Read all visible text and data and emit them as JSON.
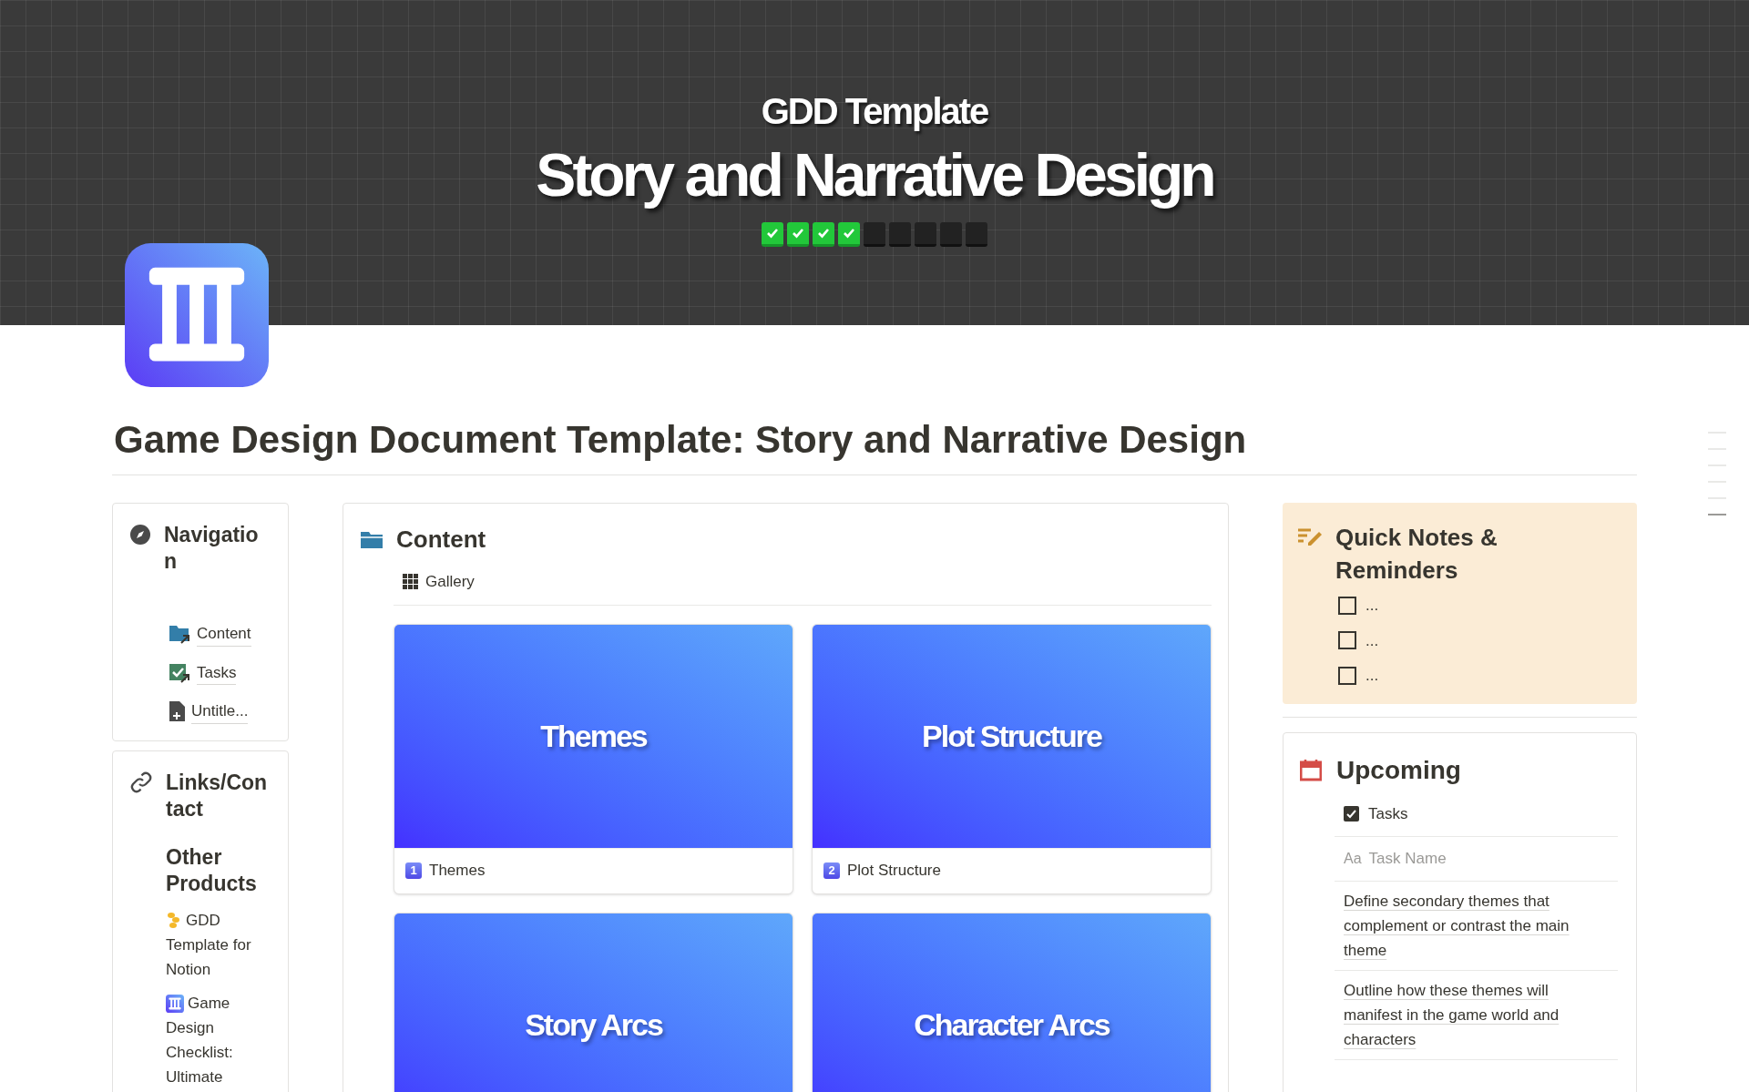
{
  "banner": {
    "subtitle": "GDD Template",
    "title": "Story and Narrative Design",
    "steps": [
      {
        "checked": true
      },
      {
        "checked": true
      },
      {
        "checked": true
      },
      {
        "checked": true
      },
      {
        "checked": false
      },
      {
        "checked": false
      },
      {
        "checked": false
      },
      {
        "checked": false
      },
      {
        "checked": false
      }
    ]
  },
  "page_title": "Game Design Document Template: Story and Narrative Design",
  "navigation": {
    "title": "Navigation",
    "links": [
      {
        "kind": "database",
        "label": "Content"
      },
      {
        "kind": "tasks",
        "label": "Tasks"
      },
      {
        "kind": "page",
        "label": "Untitle..."
      }
    ]
  },
  "links_contact": {
    "title": "Links/Contact",
    "heading": "Other Products",
    "products": [
      {
        "kind": "flower",
        "label": "GDD Template for Notion"
      },
      {
        "kind": "pillar",
        "label": "Game Design Checklist: Ultimate"
      }
    ]
  },
  "content": {
    "title": "Content",
    "view": "Gallery",
    "cards": [
      {
        "cover_title": "Themes",
        "badge": "1",
        "name": "Themes"
      },
      {
        "cover_title": "Plot Structure",
        "badge": "2",
        "name": "Plot Structure"
      },
      {
        "cover_title": "Story Arcs"
      },
      {
        "cover_title": "Character Arcs"
      }
    ]
  },
  "quick_notes": {
    "title": "Quick Notes & Reminders",
    "items": [
      {
        "text": "...",
        "checked": false
      },
      {
        "text": "...",
        "checked": false
      },
      {
        "text": "...",
        "checked": false
      }
    ]
  },
  "upcoming": {
    "title": "Upcoming",
    "view": "Tasks",
    "column_icon": "Aa",
    "column": "Task Name",
    "rows": [
      "Define secondary themes that complement or contrast the main theme",
      "Outline how these themes will manifest in the game world and characters"
    ]
  }
}
